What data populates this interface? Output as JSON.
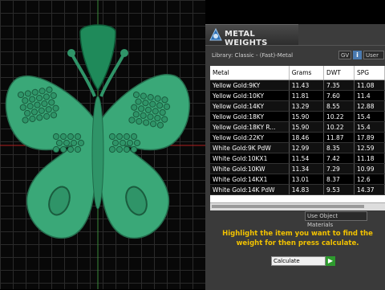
{
  "panel": {
    "title": "METAL WEIGHTS",
    "library_label": "Library: Classic - (Fast)-Metal",
    "unit_option": "GV",
    "info_label": "i",
    "user_option": "User",
    "columns": [
      "Metal",
      "Grams",
      "DWT",
      "SPG"
    ],
    "rows": [
      [
        "Yellow Gold:9KY",
        "11.43",
        "7.35",
        "11.08"
      ],
      [
        "Yellow Gold:10KY",
        "11.81",
        "7.60",
        "11.4"
      ],
      [
        "Yellow Gold:14KY",
        "13.29",
        "8.55",
        "12.88"
      ],
      [
        "Yellow Gold:18KY",
        "15.90",
        "10.22",
        "15.4"
      ],
      [
        "Yellow Gold:18KY R...",
        "15.90",
        "10.22",
        "15.4"
      ],
      [
        "Yellow Gold:22KY",
        "18.46",
        "11.87",
        "17.89"
      ],
      [
        "White Gold:9K PdW",
        "12.99",
        "8.35",
        "12.59"
      ],
      [
        "White Gold:10KX1",
        "11.54",
        "7.42",
        "11.18"
      ],
      [
        "White Gold:10KW",
        "11.34",
        "7.29",
        "10.99"
      ],
      [
        "White Gold:14KX1",
        "13.01",
        "8.37",
        "12.6"
      ],
      [
        "White Gold:14K PdW",
        "14.83",
        "9.53",
        "14.37"
      ]
    ],
    "use_object_option": "Use Object Materials",
    "hint": "Highlight the item you want to find the weight for then press calculate.",
    "calculate_label": "Calculate",
    "colors": {
      "accent": "#f2c200",
      "model": "#3aa878",
      "bail": "#1f8a5a"
    }
  }
}
